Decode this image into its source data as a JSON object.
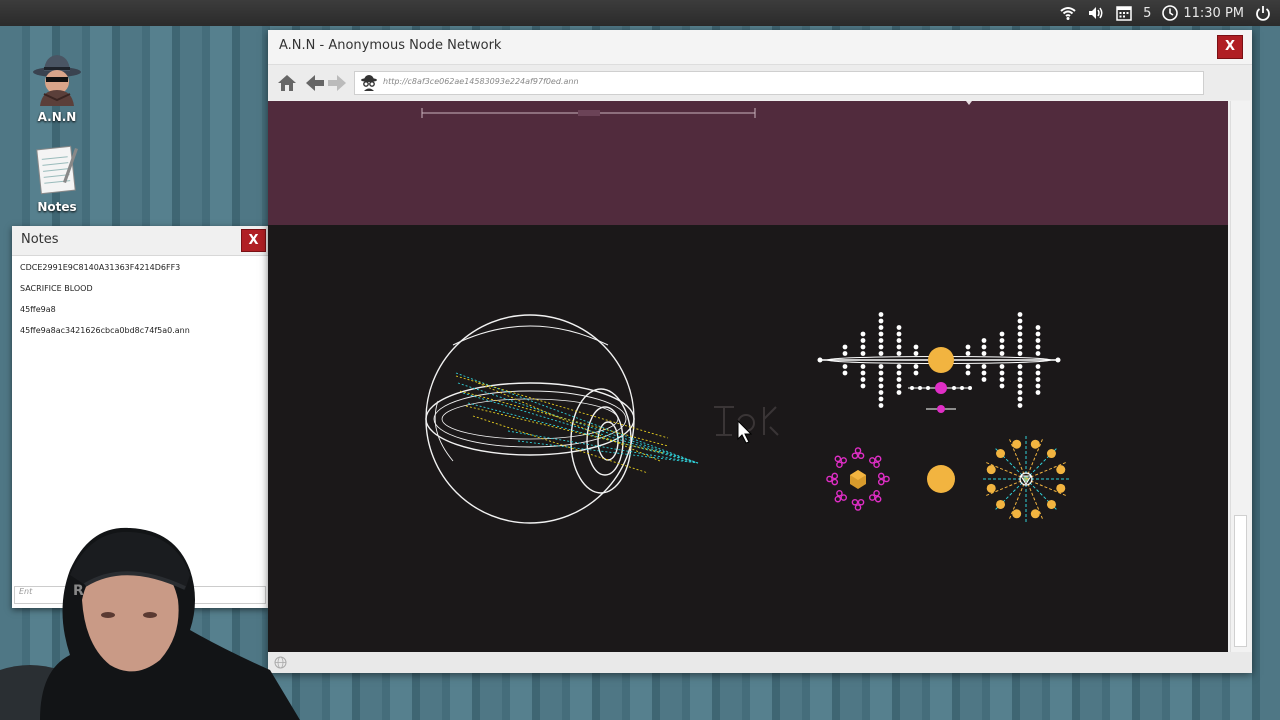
{
  "taskbar": {
    "workspace_number": "5",
    "clock": "11:30 PM",
    "icons": [
      "wifi-icon",
      "volume-icon",
      "calendar-icon",
      "clock-icon",
      "power-icon"
    ]
  },
  "desktop": {
    "icons": [
      {
        "label": "A.N.N",
        "icon": "spy-hat-icon"
      },
      {
        "label": "Notes",
        "icon": "notepad-icon"
      }
    ]
  },
  "notes_window": {
    "title": "Notes",
    "close_label": "X",
    "items": [
      "CDCE2991E9C8140A31363F4214D6FF3",
      "SACRIFICE BLOOD",
      "45ffe9a8",
      "45ffe9a8ac3421626cbca0bd8c74f5a0.ann"
    ],
    "input_placeholder": "Ent"
  },
  "browser_window": {
    "title": "A.N.N - Anonymous Node Network",
    "close_label": "X",
    "url": "http://c8af3ce062ae14583093e224af97f0ed.ann",
    "nav_icons": [
      "home-icon",
      "back-arrow-icon",
      "forward-arrow-icon"
    ],
    "page": {
      "banner_color": "#512b3d",
      "background_color": "#1b1819",
      "graphics": [
        "eye-diagram",
        "planet-orbit-diagram",
        "glyph-symbols",
        "atom-cluster-diagram",
        "sun-circle",
        "radiating-star-diagram"
      ]
    }
  },
  "colors": {
    "accent_gold": "#f2b440",
    "accent_magenta": "#e02ec6",
    "ray_yellow": "#e8d020",
    "ray_cyan": "#30d0d8",
    "close_red": "#b01f24"
  }
}
